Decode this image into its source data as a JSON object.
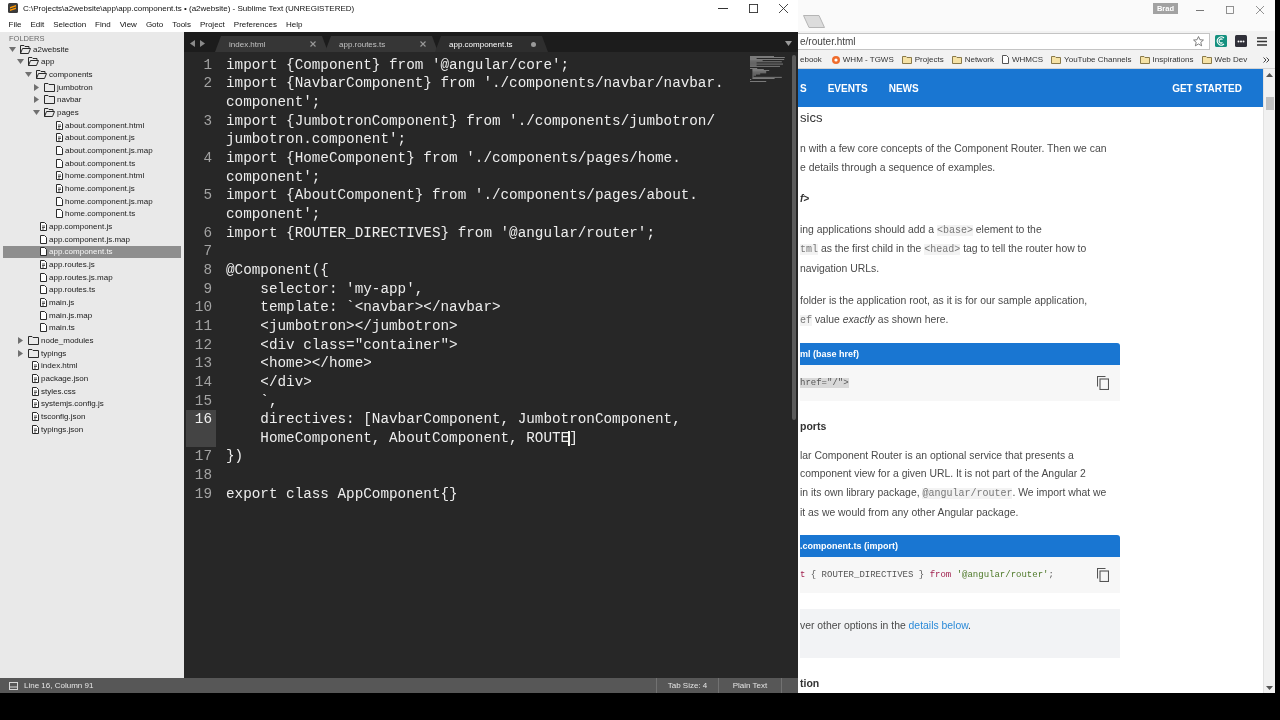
{
  "editor_window": {
    "title": "C:\\Projects\\a2website\\app\\app.component.ts • (a2website) - Sublime Text (UNREGISTERED)",
    "menu": [
      "File",
      "Edit",
      "Selection",
      "Find",
      "View",
      "Goto",
      "Tools",
      "Project",
      "Preferences",
      "Help"
    ],
    "sidebar": {
      "header": "FOLDERS",
      "items": [
        {
          "name": "a2website",
          "kind": "folder",
          "expanded": true,
          "selected": false,
          "children": [
            {
              "name": "app",
              "kind": "folder",
              "expanded": true,
              "selected": false,
              "children": [
                {
                  "name": "components",
                  "kind": "folder",
                  "expanded": true,
                  "selected": false,
                  "children": [
                    {
                      "name": "jumbotron",
                      "kind": "folder",
                      "expanded": false,
                      "selected": false
                    },
                    {
                      "name": "navbar",
                      "kind": "folder",
                      "expanded": false,
                      "selected": false
                    },
                    {
                      "name": "pages",
                      "kind": "folder",
                      "expanded": true,
                      "selected": false,
                      "children": [
                        {
                          "name": "about.component.html",
                          "kind": "doc",
                          "selected": false
                        },
                        {
                          "name": "about.component.js",
                          "kind": "doc",
                          "selected": false
                        },
                        {
                          "name": "about.component.js.map",
                          "kind": "file",
                          "selected": false
                        },
                        {
                          "name": "about.component.ts",
                          "kind": "file",
                          "selected": false
                        },
                        {
                          "name": "home.component.html",
                          "kind": "doc",
                          "selected": false
                        },
                        {
                          "name": "home.component.js",
                          "kind": "doc",
                          "selected": false
                        },
                        {
                          "name": "home.component.js.map",
                          "kind": "file",
                          "selected": false
                        },
                        {
                          "name": "home.component.ts",
                          "kind": "file",
                          "selected": false
                        }
                      ]
                    }
                  ]
                },
                {
                  "name": "app.component.js",
                  "kind": "doc",
                  "selected": false
                },
                {
                  "name": "app.component.js.map",
                  "kind": "file",
                  "selected": false
                },
                {
                  "name": "app.component.ts",
                  "kind": "file",
                  "selected": true
                },
                {
                  "name": "app.routes.js",
                  "kind": "doc",
                  "selected": false
                },
                {
                  "name": "app.routes.js.map",
                  "kind": "file",
                  "selected": false
                },
                {
                  "name": "app.routes.ts",
                  "kind": "file",
                  "selected": false
                },
                {
                  "name": "main.js",
                  "kind": "doc",
                  "selected": false
                },
                {
                  "name": "main.js.map",
                  "kind": "file",
                  "selected": false
                },
                {
                  "name": "main.ts",
                  "kind": "file",
                  "selected": false
                }
              ]
            },
            {
              "name": "node_modules",
              "kind": "folder",
              "expanded": false,
              "selected": false
            },
            {
              "name": "typings",
              "kind": "folder",
              "expanded": false,
              "selected": false
            },
            {
              "name": "index.html",
              "kind": "doc",
              "selected": false
            },
            {
              "name": "package.json",
              "kind": "doc",
              "selected": false
            },
            {
              "name": "styles.css",
              "kind": "doc",
              "selected": false
            },
            {
              "name": "systemjs.config.js",
              "kind": "doc",
              "selected": false
            },
            {
              "name": "tsconfig.json",
              "kind": "doc",
              "selected": false
            },
            {
              "name": "typings.json",
              "kind": "doc",
              "selected": false
            }
          ]
        }
      ]
    },
    "tabs": [
      {
        "label": "index.html",
        "selected": false,
        "modified": false
      },
      {
        "label": "app.routes.ts",
        "selected": false,
        "modified": false
      },
      {
        "label": "app.component.ts",
        "selected": true,
        "modified": true
      }
    ],
    "code_lines": [
      {
        "number": "1",
        "current": false,
        "rows": [
          "import {Component} from '@angular/core';"
        ]
      },
      {
        "number": "2",
        "current": false,
        "rows": [
          "import {NavbarComponent} from './components/navbar/navbar.",
          "component';"
        ]
      },
      {
        "number": "3",
        "current": false,
        "rows": [
          "import {JumbotronComponent} from './components/jumbotron/",
          "jumbotron.component';"
        ]
      },
      {
        "number": "4",
        "current": false,
        "rows": [
          "import {HomeComponent} from './components/pages/home.",
          "component';"
        ]
      },
      {
        "number": "5",
        "current": false,
        "rows": [
          "import {AboutComponent} from './components/pages/about.",
          "component';"
        ]
      },
      {
        "number": "6",
        "current": false,
        "rows": [
          "import {ROUTER_DIRECTIVES} from '@angular/router';"
        ]
      },
      {
        "number": "7",
        "current": false
      },
      {
        "number": "8",
        "current": false,
        "rows": [
          "@Component({"
        ]
      },
      {
        "number": "9",
        "current": false,
        "rows": [
          "    selector: 'my-app',"
        ]
      },
      {
        "number": "10",
        "current": false,
        "rows": [
          "    template: `<navbar></navbar>"
        ]
      },
      {
        "number": "11",
        "current": false,
        "rows": [
          "    <jumbotron></jumbotron>"
        ]
      },
      {
        "number": "12",
        "current": false,
        "rows": [
          "    <div class=\"container\">"
        ]
      },
      {
        "number": "13",
        "current": false,
        "rows": [
          "    <home></home>"
        ]
      },
      {
        "number": "14",
        "current": false,
        "rows": [
          "    </div>"
        ]
      },
      {
        "number": "15",
        "current": false,
        "rows": [
          "    `,"
        ]
      },
      {
        "number": "16",
        "current": true,
        "rows": [
          "    directives: [NavbarComponent, JumbotronComponent,",
          "    HomeComponent, AboutComponent, ROUTE]"
        ]
      },
      {
        "number": "17",
        "current": false,
        "rows": [
          "})"
        ]
      },
      {
        "number": "18",
        "current": false
      },
      {
        "number": "19",
        "current": false,
        "rows": [
          "export class AppComponent{}"
        ]
      }
    ],
    "status_bar": {
      "position": "Line 16, Column 91",
      "tab_size": "Tab Size: 4",
      "syntax": "Plain Text"
    }
  },
  "browser_window": {
    "profile": "Brad",
    "address": "e/router.html",
    "bookmarks": [
      {
        "label": "ebook",
        "kind": "plain"
      },
      {
        "label": "WHM - TGWS",
        "kind": "site"
      },
      {
        "label": "Projects",
        "kind": "folder"
      },
      {
        "label": "Network",
        "kind": "folder"
      },
      {
        "label": "WHMCS",
        "kind": "page"
      },
      {
        "label": "YouTube Channels",
        "kind": "folder"
      },
      {
        "label": "Inspirations",
        "kind": "folder"
      },
      {
        "label": "Web Dev",
        "kind": "folder"
      }
    ],
    "page": {
      "nav": [
        "S",
        "EVENTS",
        "NEWS"
      ],
      "cta": "GET STARTED",
      "content": [
        {
          "kind": "title",
          "text": "sics"
        },
        {
          "kind": "paragraph",
          "lines": [
            [
              {
                "kind": "text",
                "text": "n with a few core concepts of the Component Router. Then we can"
              }
            ],
            [
              {
                "kind": "text",
                "text": "e details through a sequence of examples."
              }
            ]
          ]
        },
        {
          "kind": "code_heading",
          "text": "f>"
        },
        {
          "kind": "paragraph",
          "lines": [
            [
              {
                "kind": "text",
                "text": "ing applications should add a "
              },
              {
                "kind": "code",
                "text": "<base>"
              },
              {
                "kind": "text",
                "text": " element to the"
              }
            ],
            [
              {
                "kind": "code",
                "text": "tml"
              },
              {
                "kind": "text",
                "text": " as the first child in the "
              },
              {
                "kind": "code",
                "text": "<head>"
              },
              {
                "kind": "text",
                "text": " tag to tell the router how to"
              }
            ],
            [
              {
                "kind": "text",
                "text": "navigation URLs."
              }
            ]
          ]
        },
        {
          "kind": "paragraph",
          "lines": [
            [
              {
                "kind": "text",
                "text": "folder is the application root, as it is for our sample application,"
              }
            ],
            [
              {
                "kind": "code",
                "text": "ef"
              },
              {
                "kind": "text",
                "text": " value *exactly* as shown here."
              }
            ]
          ]
        },
        {
          "kind": "code_block",
          "title": "ml (base href)",
          "lines": [
            [
              {
                "kind": "selection",
                "text": "href=\"/\">"
              }
            ]
          ]
        },
        {
          "kind": "heading",
          "text": "ports"
        },
        {
          "kind": "paragraph",
          "lines": [
            [
              {
                "kind": "text",
                "text": "lar Component Router is an optional service that presents a"
              }
            ],
            [
              {
                "kind": "text",
                "text": "component view for a given URL. It is not part of the Angular 2"
              }
            ],
            [
              {
                "kind": "text",
                "text": "in its own library package, "
              },
              {
                "kind": "code",
                "text": "@angular/router"
              },
              {
                "kind": "text",
                "text": ". We import what we"
              }
            ],
            [
              {
                "kind": "text",
                "text": "it as we would from any other Angular package."
              }
            ]
          ]
        },
        {
          "kind": "code_block",
          "title": ".component.ts (import)",
          "lines": [
            [
              {
                "kind": "keyword",
                "text": "t"
              },
              {
                "kind": "plain",
                "text": " { ROUTER_DIRECTIVES } "
              },
              {
                "kind": "keyword",
                "text": "from"
              },
              {
                "kind": "string",
                "text": " '@angular/router'"
              },
              {
                "kind": "plain",
                "text": ";"
              }
            ]
          ]
        },
        {
          "kind": "note",
          "lines": [
            [
              {
                "kind": "text",
                "text": "ver other options in the "
              },
              {
                "kind": "link",
                "text": "details below"
              },
              {
                "kind": "text",
                "text": "."
              }
            ]
          ]
        },
        {
          "kind": "heading",
          "text": "tion"
        }
      ]
    }
  }
}
